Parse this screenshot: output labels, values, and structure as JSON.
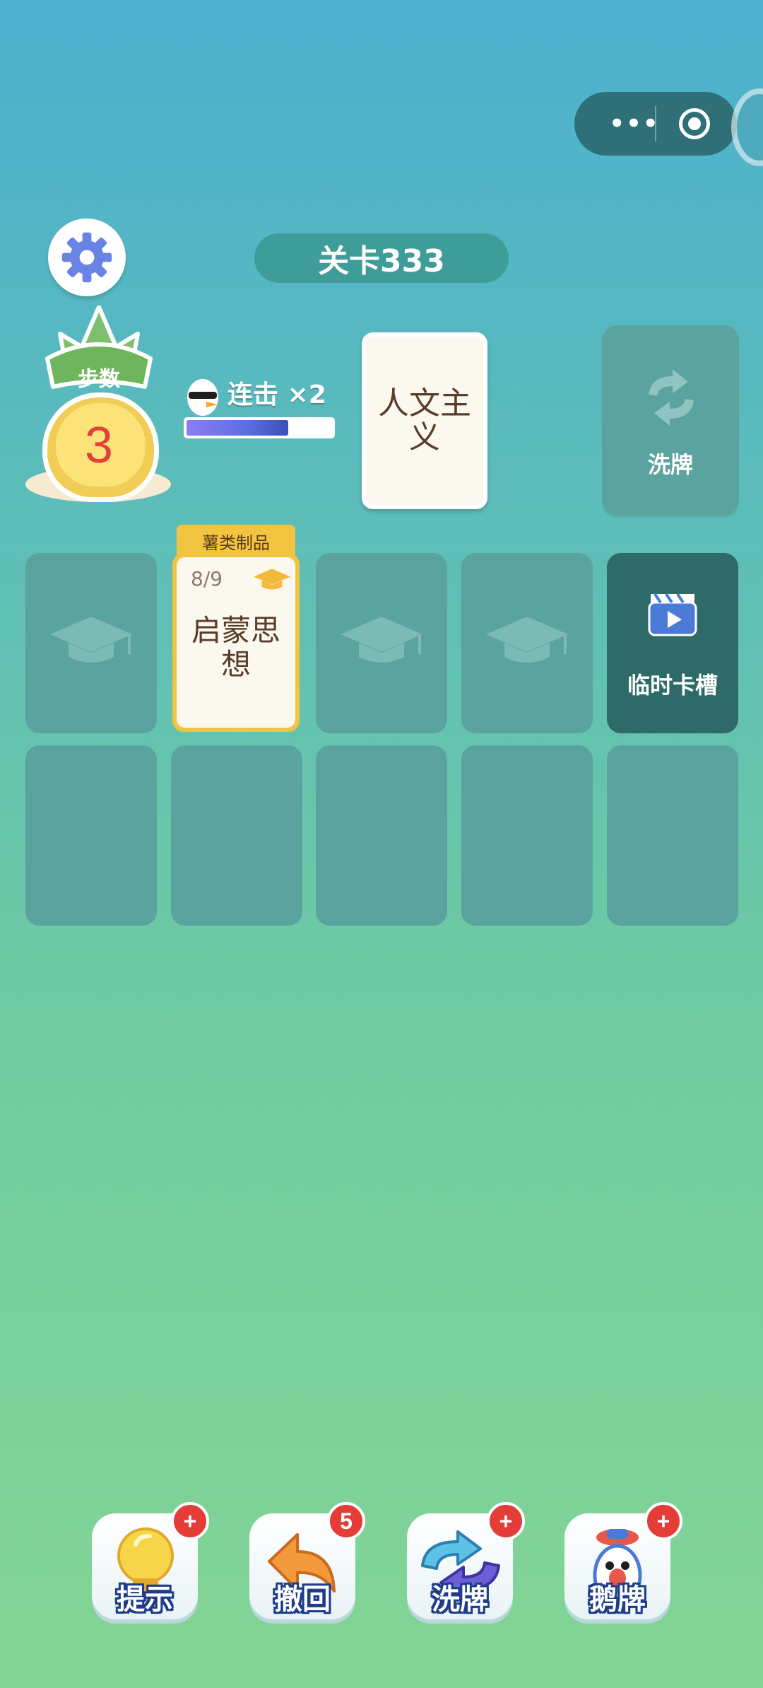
{
  "capsule": {
    "more_icon": "more-dots-icon",
    "close_icon": "target-close-icon"
  },
  "header": {
    "level_label": "关卡333"
  },
  "steps": {
    "label": "步数",
    "value": "3"
  },
  "combo": {
    "label": "连击 ×2",
    "progress": 0.7
  },
  "current_card": {
    "text": "人文主义"
  },
  "shuffle_top": {
    "label": "洗牌"
  },
  "slots_row1": [
    {
      "type": "empty"
    },
    {
      "type": "card",
      "tag": "薯类制品",
      "count": "8/9",
      "text": "启蒙思想"
    },
    {
      "type": "empty"
    },
    {
      "type": "empty"
    },
    {
      "type": "temp",
      "label": "临时卡槽"
    }
  ],
  "toolbar": {
    "hint": {
      "label": "提示",
      "badge": "+"
    },
    "undo": {
      "label": "撤回",
      "badge": "5"
    },
    "shuffle": {
      "label": "洗牌",
      "badge": "+"
    },
    "goose": {
      "label": "鹅牌",
      "badge": "+"
    }
  },
  "colors": {
    "slot": "#5aa39e",
    "card_border": "#f3c440",
    "badge": "#e43c37"
  }
}
